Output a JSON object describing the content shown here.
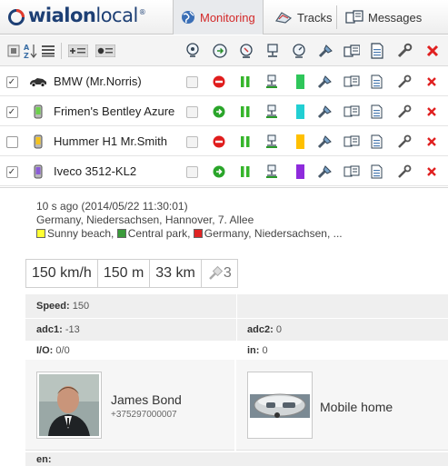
{
  "app": {
    "logo": "wialon local",
    "logo_part1": "wialon",
    "logo_part2": "local"
  },
  "tabs": [
    {
      "label": "Monitoring",
      "icon": "globe-icon",
      "active": true
    },
    {
      "label": "Tracks",
      "icon": "tracks-icon",
      "active": false
    },
    {
      "label": "Messages",
      "icon": "messages-icon",
      "active": false
    }
  ],
  "toolbar": {
    "left_icons": [
      "select-all-icon",
      "sort-az-icon",
      "list-icon",
      "add-group-icon",
      "group-view-icon"
    ],
    "column_icons": [
      "location-icon",
      "commands-icon",
      "drive-icon",
      "sensor-icon",
      "speed-icon",
      "tools-icon",
      "notifications-icon",
      "report-icon",
      "wrench-icon",
      "delete-icon"
    ]
  },
  "units": [
    {
      "name": "BMW (Mr.Norris)",
      "checked": true,
      "motion": "stop",
      "status_color": "#2fc65a",
      "icon": "car-icon"
    },
    {
      "name": "Frimen's Bentley Azure",
      "checked": true,
      "motion": "go",
      "status_color": "#22cfd3",
      "icon": "phone-green-icon"
    },
    {
      "name": "Hummer H1 Mr.Smith",
      "checked": false,
      "motion": "stop",
      "status_color": "#ffc000",
      "icon": "phone-yellow-icon"
    },
    {
      "name": "Iveco 3512-KL2",
      "checked": true,
      "motion": "go",
      "status_color": "#8e2bdc",
      "icon": "phone-purple-icon"
    }
  ],
  "detail": {
    "time": "10 s ago (2014/05/22 11:30:01)",
    "address": "Germany, Niedersachsen, Hannover, 7. Allee",
    "geofences": [
      {
        "label": "Sunny beach,",
        "color": "#ffff33"
      },
      {
        "label": "Central park,",
        "color": "#3a9a3a"
      },
      {
        "label": "Germany, Niedersachsen, ...",
        "color": "#e02424"
      }
    ],
    "stats": {
      "speed": "150 km/h",
      "altitude": "150 m",
      "mileage": "33 km",
      "satellites": "3"
    },
    "params": {
      "speed_label": "Speed:",
      "speed_value": "150",
      "adc1_label": "adc1:",
      "adc1_value": "-13",
      "adc2_label": "adc2:",
      "adc2_value": "0",
      "io_label": "I/O:",
      "io_value": "0/0",
      "in_label": "in:",
      "in_value": "0",
      "en_label": "en:"
    },
    "driver": {
      "name": "James Bond",
      "phone": "+375297000007"
    },
    "trailer": {
      "name": "Mobile home"
    }
  }
}
